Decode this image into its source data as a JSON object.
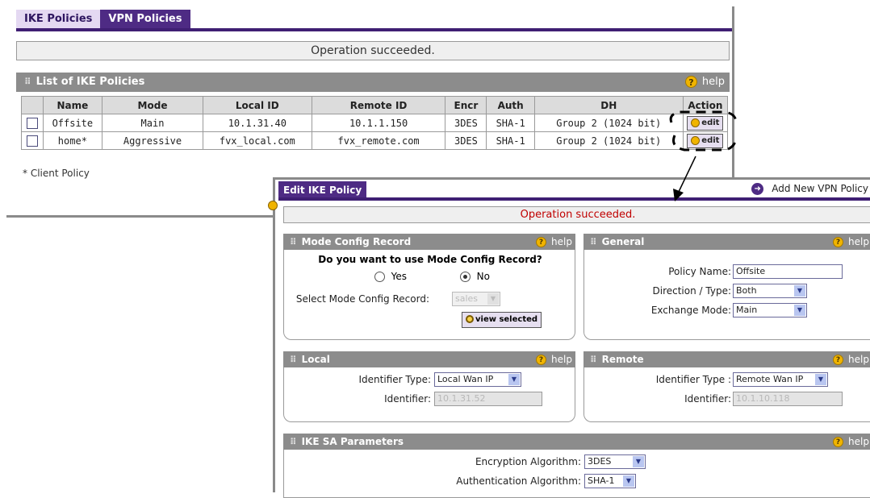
{
  "back": {
    "tabs": [
      {
        "label": "IKE Policies"
      },
      {
        "label": "VPN Policies"
      }
    ],
    "status": "Operation succeeded.",
    "section_title": "List of IKE Policies",
    "help": "help",
    "columns": [
      "Name",
      "Mode",
      "Local ID",
      "Remote ID",
      "Encr",
      "Auth",
      "DH",
      "Action"
    ],
    "rows": [
      {
        "name": "Offsite",
        "mode": "Main",
        "local_id": "10.1.31.40",
        "remote_id": "10.1.1.150",
        "encr": "3DES",
        "auth": "SHA-1",
        "dh": "Group 2 (1024 bit)",
        "action": "edit"
      },
      {
        "name": "home*",
        "mode": "Aggressive",
        "local_id": "fvx_local.com",
        "remote_id": "fvx_remote.com",
        "encr": "3DES",
        "auth": "SHA-1",
        "dh": "Group 2 (1024 bit)",
        "action": "edit"
      }
    ],
    "client_note": "* Client Policy"
  },
  "front": {
    "tab": "Edit IKE Policy",
    "add_vpn": "Add New VPN Policy",
    "status": "Operation succeeded.",
    "help": "help",
    "mode_config": {
      "title": "Mode Config Record",
      "question": "Do you want to use Mode Config Record?",
      "yes": "Yes",
      "no": "No",
      "selected": "No",
      "select_label": "Select Mode Config Record:",
      "select_value": "sales",
      "view_button": "view selected"
    },
    "general": {
      "title": "General",
      "policy_name_label": "Policy Name:",
      "policy_name": "Offsite",
      "direction_label": "Direction / Type:",
      "direction": "Both",
      "exchange_label": "Exchange Mode:",
      "exchange": "Main"
    },
    "local": {
      "title": "Local",
      "id_type_label": "Identifier Type:",
      "id_type": "Local Wan IP",
      "id_label": "Identifier:",
      "id": "10.1.31.52"
    },
    "remote": {
      "title": "Remote",
      "id_type_label": "Identifier Type :",
      "id_type": "Remote Wan IP",
      "id_label": "Identifier:",
      "id": "10.1.10.118"
    },
    "ike_sa": {
      "title": "IKE SA Parameters",
      "encr_label": "Encryption Algorithm:",
      "encr": "3DES",
      "auth_label": "Authentication Algorithm:",
      "auth": "SHA-1"
    }
  }
}
